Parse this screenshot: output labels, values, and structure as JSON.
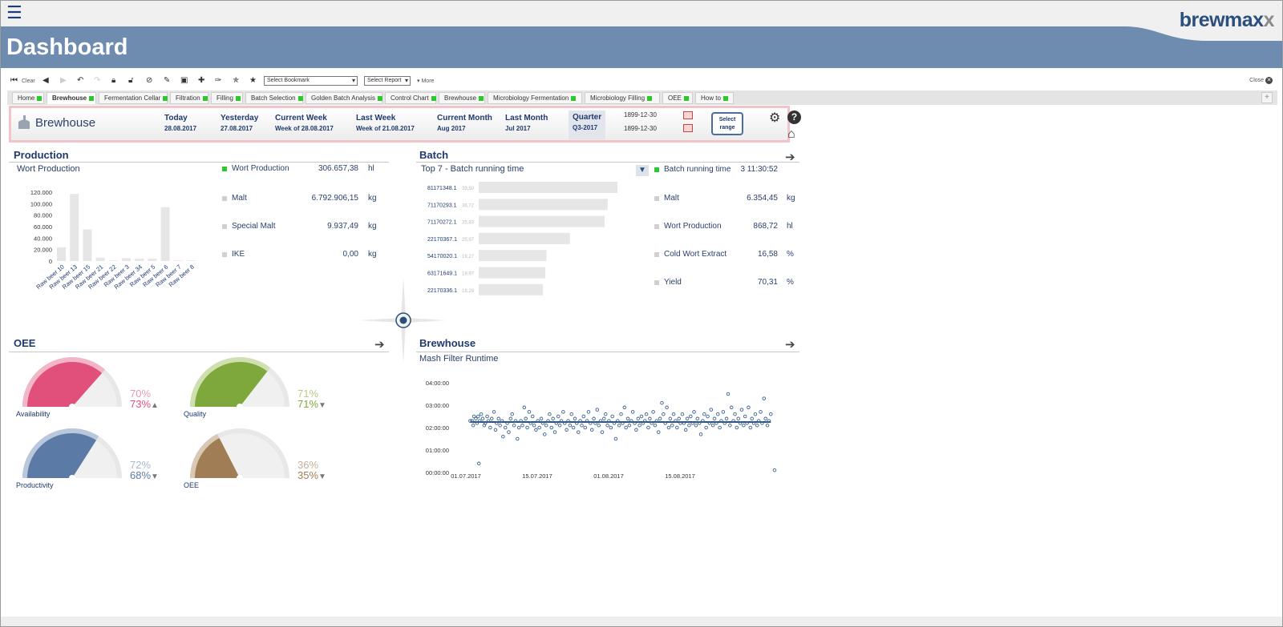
{
  "header": {
    "page_title": "Dashboard",
    "logo_main": "brewmax",
    "logo_x": "x",
    "menu_glyph": "☰"
  },
  "toolbar": {
    "clear_label": "Clear",
    "bookmark_select": "Select Bookmark",
    "report_select": "Select Report",
    "more_label": "More",
    "close_label": "Close"
  },
  "tabs": [
    {
      "label": "Home",
      "active": false
    },
    {
      "label": "Brewhouse",
      "active": true
    },
    {
      "label": "Fermentation Cellar",
      "active": false
    },
    {
      "label": "Filtration",
      "active": false
    },
    {
      "label": "Filling",
      "active": false
    },
    {
      "label": "Batch Selection",
      "active": false
    },
    {
      "label": "Golden Batch Analysis",
      "active": false
    },
    {
      "label": "Control Chart",
      "active": false
    },
    {
      "label": "Brewhouse",
      "active": false
    },
    {
      "label": "Microbiology Fermentation",
      "active": false
    },
    {
      "label": "Microbiology Filling",
      "active": false
    },
    {
      "label": "OEE",
      "active": false
    },
    {
      "label": "How to",
      "active": false
    }
  ],
  "filter": {
    "title": "Brewhouse",
    "periods": [
      {
        "label": "Today",
        "sub": "28.08.2017"
      },
      {
        "label": "Yesterday",
        "sub": "27.08.2017"
      },
      {
        "label": "Current Week",
        "sub": "Week of 28.08.2017"
      },
      {
        "label": "Last Week",
        "sub": "Week of 21.08.2017"
      },
      {
        "label": "Current Month",
        "sub": "Aug 2017"
      },
      {
        "label": "Last Month",
        "sub": "Jul 2017"
      },
      {
        "label": "Quarter",
        "sub": "Q3-2017"
      }
    ],
    "date_from": "1899-12-30",
    "date_to": "1899-12-30",
    "select_range_line1": "Select",
    "select_range_line2": "range"
  },
  "production": {
    "title": "Production",
    "chart_title": "Wort Production",
    "kpis": [
      {
        "label": "Wort Production",
        "value": "306.657,38",
        "unit": "hl",
        "active": true
      },
      {
        "label": "Malt",
        "value": "6.792.906,15",
        "unit": "kg",
        "active": false
      },
      {
        "label": "Special Malt",
        "value": "9.937,49",
        "unit": "kg",
        "active": false
      },
      {
        "label": "IKE",
        "value": "0,00",
        "unit": "kg",
        "active": false
      }
    ]
  },
  "batch": {
    "title": "Batch",
    "chart_title": "Top 7 - Batch running time",
    "kpis": [
      {
        "label": "Batch running time",
        "value": "3 11:30:52",
        "unit": "",
        "active": true
      },
      {
        "label": "Malt",
        "value": "6.354,45",
        "unit": "kg",
        "active": false
      },
      {
        "label": "Wort Production",
        "value": "868,72",
        "unit": "hl",
        "active": false
      },
      {
        "label": "Cold Wort Extract",
        "value": "16,58",
        "unit": "%",
        "active": false
      },
      {
        "label": "Yield",
        "value": "70,31",
        "unit": "%",
        "active": false
      }
    ]
  },
  "oee": {
    "title": "OEE",
    "gauges": [
      {
        "label": "Availability",
        "target": "70%",
        "actual": "73%",
        "trend": "▲",
        "value": 0.73,
        "color": "#e0507a",
        "light": "#f2b6c8",
        "target_color": "#e89ab0"
      },
      {
        "label": "Quality",
        "target": "71%",
        "actual": "71%",
        "trend": "▼",
        "value": 0.71,
        "color": "#7fa83c",
        "light": "#cfe0b0",
        "target_color": "#b8cc8c"
      },
      {
        "label": "Productivity",
        "target": "72%",
        "actual": "68%",
        "trend": "▼",
        "value": 0.68,
        "color": "#5b7ba6",
        "light": "#b9c8dc",
        "target_color": "#a9b8cc"
      },
      {
        "label": "OEE",
        "target": "36%",
        "actual": "35%",
        "trend": "▼",
        "value": 0.35,
        "color": "#a07d55",
        "light": "#d8c8b4",
        "target_color": "#c4b09a"
      }
    ]
  },
  "brewhouse": {
    "title": "Brewhouse",
    "chart_title": "Mash Filter Runtime"
  },
  "chart_data": [
    {
      "type": "bar",
      "title": "Wort Production",
      "categories": [
        "Raw beer 10",
        "Raw beer 13",
        "Raw beer 15",
        "Raw beer 21",
        "Raw beer 22",
        "Raw beer 3",
        "Raw beer 34",
        "Raw beer 5",
        "Raw beer 6",
        "Raw beer 7",
        "Raw beer 8"
      ],
      "values": [
        24000,
        117000,
        55000,
        6000,
        1000,
        5000,
        4000,
        4000,
        94000,
        500,
        500
      ],
      "ylim": [
        0,
        120000
      ],
      "yticks": [
        "0",
        "20.000",
        "40.000",
        "60.000",
        "80.000",
        "100.000",
        "120.000"
      ]
    },
    {
      "type": "bar",
      "orientation": "horizontal",
      "title": "Top 7 - Batch running time",
      "categories": [
        "81171348.1",
        "71170293.1",
        "71170272.1",
        "22170367.1",
        "54170020.1",
        "63171649.1",
        "22170336.1"
      ],
      "values": [
        39.5,
        36.72,
        35.83,
        25.97,
        19.27,
        18.97,
        18.29
      ],
      "value_labels": [
        "39,50",
        "36,72",
        "35,83",
        "25,97",
        "19,27",
        "18,97",
        "18,29"
      ]
    },
    {
      "type": "scatter",
      "title": "Mash Filter Runtime",
      "xlabels": [
        "01.07.2017",
        "15.07.2017",
        "01.08.2017",
        "15.08.2017"
      ],
      "yticks": [
        "00:00:00",
        "01:00:00",
        "02:00:00",
        "03:00:00",
        "04:00:00"
      ],
      "ylim": [
        0,
        4
      ],
      "mean": 2.25,
      "points": [
        [
          1,
          2.3
        ],
        [
          1.3,
          2.1
        ],
        [
          1.5,
          2.5
        ],
        [
          2,
          2.4
        ],
        [
          2.3,
          2.2
        ],
        [
          2.6,
          2.5
        ],
        [
          3,
          2.3
        ],
        [
          3.4,
          2.6
        ],
        [
          3.8,
          2.4
        ],
        [
          4.2,
          2.1
        ],
        [
          4.5,
          2.2
        ],
        [
          5,
          2.5
        ],
        [
          5.3,
          2.3
        ],
        [
          5.8,
          2.0
        ],
        [
          6.2,
          2.4
        ],
        [
          6.8,
          2.7
        ],
        [
          7.2,
          1.9
        ],
        [
          7.5,
          2.2
        ],
        [
          8,
          2.4
        ],
        [
          8.4,
          2.1
        ],
        [
          8.9,
          2.3
        ],
        [
          9.2,
          1.6
        ],
        [
          9.8,
          2.0
        ],
        [
          10.3,
          2.2
        ],
        [
          10.7,
          1.8
        ],
        [
          11.2,
          2.4
        ],
        [
          11.6,
          2.6
        ],
        [
          12.1,
          2.1
        ],
        [
          12.5,
          2.3
        ],
        [
          13,
          1.5
        ],
        [
          13.4,
          2.0
        ],
        [
          13.9,
          2.3
        ],
        [
          14.3,
          2.1
        ],
        [
          14.8,
          2.9
        ],
        [
          15.2,
          2.4
        ],
        [
          15.6,
          2.0
        ],
        [
          16.1,
          2.7
        ],
        [
          16.5,
          2.2
        ],
        [
          17,
          2.5
        ],
        [
          17.4,
          2.1
        ],
        [
          17.9,
          1.9
        ],
        [
          18.4,
          2.3
        ],
        [
          18.8,
          2.0
        ],
        [
          19.3,
          2.4
        ],
        [
          19.7,
          2.2
        ],
        [
          20.2,
          1.7
        ],
        [
          20.6,
          2.1
        ],
        [
          21.1,
          2.3
        ],
        [
          21.5,
          2.6
        ],
        [
          22,
          2.0
        ],
        [
          22.4,
          2.4
        ],
        [
          22.9,
          1.8
        ],
        [
          23.3,
          2.2
        ],
        [
          23.8,
          2.5
        ],
        [
          24.2,
          2.1
        ],
        [
          24.6,
          2.3
        ],
        [
          25.1,
          2.7
        ],
        [
          25.5,
          2.2
        ],
        [
          26,
          1.9
        ],
        [
          26.4,
          2.3
        ],
        [
          26.9,
          2.1
        ],
        [
          27.3,
          2.6
        ],
        [
          27.8,
          2.0
        ],
        [
          28.2,
          2.4
        ],
        [
          28.7,
          2.2
        ],
        [
          29.1,
          1.8
        ],
        [
          29.6,
          2.3
        ],
        [
          30,
          2.1
        ],
        [
          30.5,
          2.5
        ],
        [
          30.9,
          2.0
        ],
        [
          31.4,
          2.3
        ],
        [
          31.8,
          2.7
        ],
        [
          32.3,
          2.2
        ],
        [
          32.7,
          1.9
        ],
        [
          33.2,
          2.4
        ],
        [
          33.6,
          2.2
        ],
        [
          34.1,
          2.8
        ],
        [
          34.5,
          2.1
        ],
        [
          35,
          2.3
        ],
        [
          35.4,
          1.8
        ],
        [
          35.9,
          2.4
        ],
        [
          36.3,
          2.6
        ],
        [
          36.8,
          2.1
        ],
        [
          37.2,
          2.3
        ],
        [
          37.7,
          2.0
        ],
        [
          38.1,
          2.5
        ],
        [
          38.6,
          2.2
        ],
        [
          39,
          1.5
        ],
        [
          39.5,
          2.3
        ],
        [
          39.9,
          2.1
        ],
        [
          40.4,
          2.6
        ],
        [
          40.8,
          2.2
        ],
        [
          41.3,
          2.9
        ],
        [
          41.7,
          2.0
        ],
        [
          42.2,
          2.4
        ],
        [
          42.6,
          2.1
        ],
        [
          43.1,
          2.3
        ],
        [
          43.5,
          2.7
        ],
        [
          44,
          2.2
        ],
        [
          44.4,
          1.9
        ],
        [
          44.9,
          2.4
        ],
        [
          45.3,
          2.1
        ],
        [
          45.8,
          2.5
        ],
        [
          46.2,
          2.2
        ],
        [
          46.7,
          2.3
        ],
        [
          47.1,
          2.6
        ],
        [
          47.6,
          2.0
        ],
        [
          48,
          2.4
        ],
        [
          48.5,
          2.2
        ],
        [
          48.9,
          2.7
        ],
        [
          49.4,
          2.1
        ],
        [
          49.8,
          2.3
        ],
        [
          50.3,
          1.8
        ],
        [
          50.7,
          2.4
        ],
        [
          51.2,
          3.1
        ],
        [
          51.6,
          2.6
        ],
        [
          52.1,
          2.2
        ],
        [
          52.5,
          2.9
        ],
        [
          53,
          2.0
        ],
        [
          53.4,
          2.4
        ],
        [
          53.9,
          2.1
        ],
        [
          54.3,
          2.6
        ],
        [
          54.8,
          2.3
        ],
        [
          55.2,
          2.0
        ],
        [
          55.7,
          2.4
        ],
        [
          56.1,
          2.2
        ],
        [
          56.6,
          2.6
        ],
        [
          57,
          2.2
        ],
        [
          57.5,
          1.9
        ],
        [
          57.9,
          2.4
        ],
        [
          58.4,
          2.1
        ],
        [
          58.8,
          2.5
        ],
        [
          59.3,
          2.2
        ],
        [
          59.7,
          2.7
        ],
        [
          60.2,
          2.1
        ],
        [
          60.6,
          2.4
        ],
        [
          61.1,
          2.2
        ],
        [
          61.5,
          1.7
        ],
        [
          62,
          2.3
        ],
        [
          62.4,
          2.6
        ],
        [
          62.9,
          2.0
        ],
        [
          63.3,
          2.5
        ],
        [
          63.8,
          2.2
        ],
        [
          64.2,
          2.8
        ],
        [
          64.7,
          2.1
        ],
        [
          65.1,
          2.4
        ],
        [
          65.6,
          2.2
        ],
        [
          66,
          2.6
        ],
        [
          66.5,
          2.0
        ],
        [
          66.9,
          2.3
        ],
        [
          67.4,
          2.7
        ],
        [
          67.8,
          2.2
        ],
        [
          68.3,
          2.4
        ],
        [
          68.7,
          3.5
        ],
        [
          69.2,
          2.1
        ],
        [
          69.6,
          2.9
        ],
        [
          70.1,
          2.3
        ],
        [
          70.5,
          2.6
        ],
        [
          71,
          2.0
        ],
        [
          71.4,
          2.4
        ],
        [
          71.9,
          2.2
        ],
        [
          72.3,
          2.8
        ],
        [
          72.8,
          2.1
        ],
        [
          73.2,
          2.5
        ],
        [
          73.7,
          2.2
        ],
        [
          74.1,
          2.9
        ],
        [
          74.6,
          2.0
        ],
        [
          75,
          2.4
        ],
        [
          75.5,
          2.2
        ],
        [
          75.9,
          2.6
        ],
        [
          76.4,
          2.1
        ],
        [
          76.8,
          2.3
        ],
        [
          77.3,
          2.7
        ],
        [
          77.7,
          2.2
        ],
        [
          78.2,
          3.3
        ],
        [
          78.6,
          2.4
        ],
        [
          79.1,
          2.1
        ],
        [
          79.5,
          2.3
        ],
        [
          80,
          2.6
        ],
        [
          0.5,
          2.3
        ],
        [
          2.8,
          0.4
        ],
        [
          81,
          0.1
        ]
      ]
    }
  ]
}
